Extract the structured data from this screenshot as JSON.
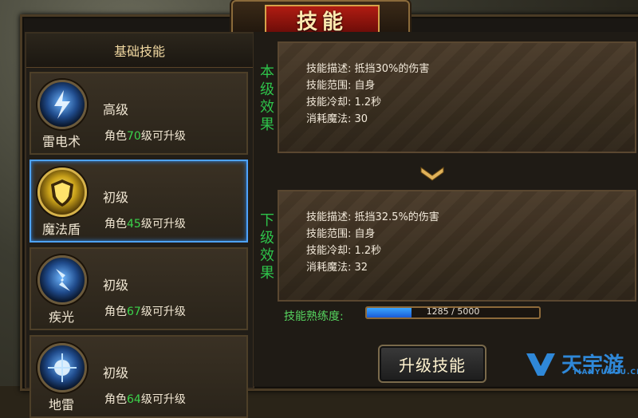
{
  "window": {
    "title": "技能",
    "close_label": "✕"
  },
  "left_panel": {
    "header": "基础技能",
    "skills": [
      {
        "name": "雷电术",
        "level": "高级",
        "req_prefix": "角色",
        "req_level": "70",
        "req_suffix": "级可升级",
        "icon": "lightning-icon",
        "selected": false
      },
      {
        "name": "魔法盾",
        "level": "初级",
        "req_prefix": "角色",
        "req_level": "45",
        "req_suffix": "级可升级",
        "icon": "shield-icon",
        "selected": true
      },
      {
        "name": "疾光",
        "level": "初级",
        "req_prefix": "角色",
        "req_level": "67",
        "req_suffix": "级可升级",
        "icon": "flash-icon",
        "selected": false
      },
      {
        "name": "地雷",
        "level": "初级",
        "req_prefix": "角色",
        "req_level": "64",
        "req_suffix": "级可升级",
        "icon": "mine-icon",
        "selected": false
      }
    ]
  },
  "current_effect": {
    "title": [
      "本",
      "级",
      "效",
      "果"
    ],
    "lines": [
      "技能描述: 抵挡30%的伤害",
      "技能范围: 自身",
      "技能冷却: 1.2秒",
      "消耗魔法: 30"
    ]
  },
  "next_effect": {
    "title": [
      "下",
      "级",
      "效",
      "果"
    ],
    "lines": [
      "技能描述: 抵挡32.5%的伤害",
      "技能范围: 自身",
      "技能冷却: 1.2秒",
      "消耗魔法: 32"
    ]
  },
  "proficiency": {
    "label": "技能熟练度:",
    "value_text": "1285 / 5000",
    "fraction": 0.257
  },
  "upgrade_button": {
    "label": "升级技能"
  },
  "watermark": {
    "text": "天宇游",
    "url_text": "TIANYUYOU.CN"
  },
  "colors": {
    "accent_green": "#3bd34b",
    "selection_blue": "#4ea3ff",
    "title_red": "#b01c12"
  }
}
